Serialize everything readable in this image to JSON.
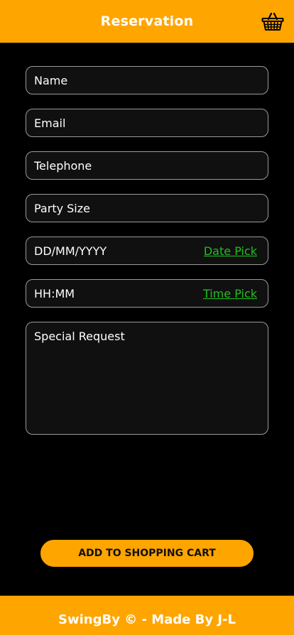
{
  "header": {
    "title": "Reservation",
    "cart_icon": "shopping-basket-icon"
  },
  "form": {
    "name_placeholder": "Name",
    "email_placeholder": "Email",
    "telephone_placeholder": "Telephone",
    "party_size_placeholder": "Party Size",
    "date_placeholder": "DD/MM/YYYY",
    "date_picker_label": "Date Pick",
    "time_placeholder": "HH:MM",
    "time_picker_label": "Time Pick",
    "special_request_placeholder": "Special Request"
  },
  "actions": {
    "add_to_cart_label": "ADD TO SHOPPING CART"
  },
  "footer": {
    "text": "SwingBy © - Made By J-L"
  },
  "colors": {
    "brand": "#FFA500",
    "background": "#000000",
    "link": "#1FC11F",
    "field_border": "#9A9A9A"
  }
}
